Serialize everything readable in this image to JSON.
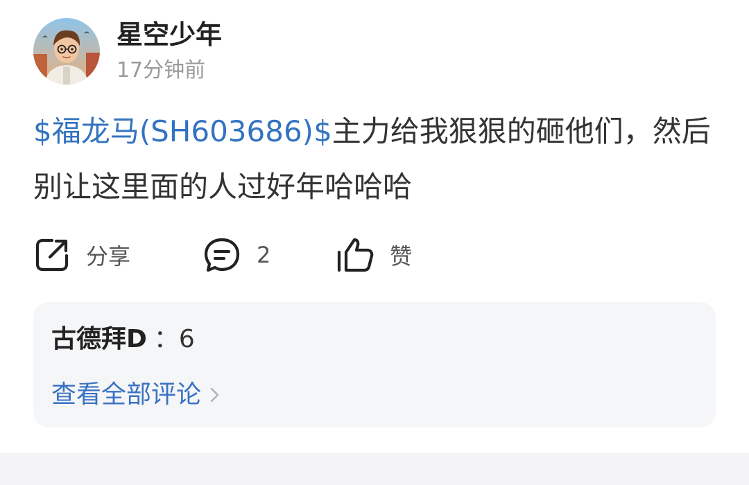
{
  "post": {
    "author": {
      "name": "星空少年",
      "time": "17分钟前"
    },
    "content": {
      "stock_tag": "$福龙马(SH603686)$",
      "text": "主力给我狠狠的砸他们，然后别让这里面的人过好年哈哈哈"
    },
    "actions": {
      "share_label": "分享",
      "comment_count": "2",
      "like_label": "赞"
    },
    "comments": {
      "items": [
        {
          "author": "古德拜D",
          "separator": "：",
          "text": "6"
        }
      ],
      "view_all_label": "查看全部评论"
    }
  },
  "colors": {
    "link": "#3373c0",
    "text": "#333333",
    "muted": "#9a9a9a",
    "comment_bg": "#f5f6f8"
  },
  "icons": {
    "share": "share-icon",
    "comment": "comment-icon",
    "like": "thumbs-up-icon",
    "chevron": "chevron-right-icon"
  }
}
